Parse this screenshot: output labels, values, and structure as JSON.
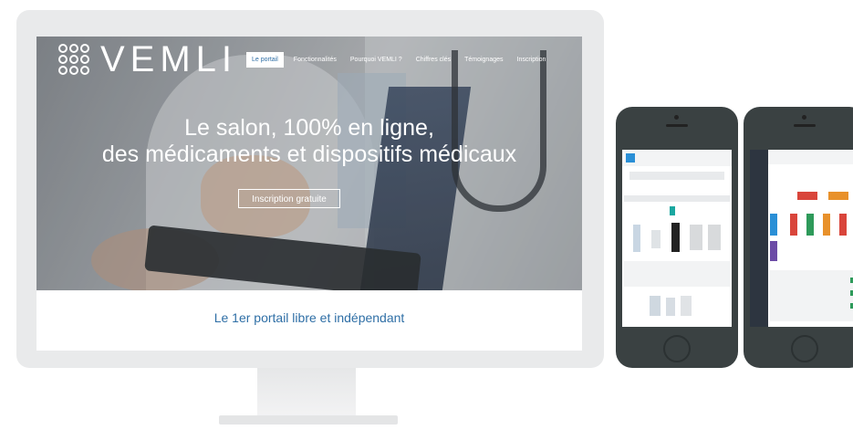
{
  "brand": {
    "name": "VEMLI"
  },
  "nav": {
    "items": [
      "Le portail",
      "Fonctionnalités",
      "Pourquoi VEMLI ?",
      "Chiffres clés",
      "Témoignages",
      "Inscription"
    ],
    "active": "Le portail"
  },
  "hero": {
    "line1": "Le salon, 100% en ligne,",
    "line2": "des médicaments et dispositifs médicaux",
    "cta": "Inscription gratuite"
  },
  "tagline": "Le 1er portail libre et indépendant",
  "colors": {
    "accent": "#2f6fa6",
    "orange": "#e8912b",
    "red": "#d9453b",
    "green": "#2e9a5a",
    "purple": "#6c4ba6",
    "blue": "#2a8fd6",
    "teal": "#1aa7a0"
  }
}
